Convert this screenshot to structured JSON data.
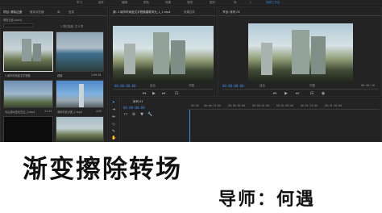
{
  "menu": [
    "学习",
    "组件",
    "编辑",
    "颜色",
    "效果",
    "音频",
    "图形",
    "库",
    "》",
    "视频工作区"
  ],
  "project_panel": {
    "tabs": [
      "项目: 擦除过渡",
      "媒体浏览器",
      "库",
      "信息"
    ],
    "file": "擦除过渡.prproj",
    "count": "1 项已选择, 共 5 项",
    "items": [
      {
        "label": "2.城市时间延文字镜像",
        "duration": ""
      },
      {
        "label": "视频",
        "duration": "1:09:18"
      },
      {
        "label": "青山绿水蓝天白云_1.mp4",
        "duration": "11:13"
      },
      {
        "label": "深圳平安大厦_1.mp4",
        "duration": "4:00"
      },
      {
        "label": "序列 14_1_1.mp4",
        "duration": ""
      },
      {
        "label": "",
        "duration": "11:13"
      }
    ]
  },
  "source_panel": {
    "tabs": [
      "源: 2.城市时间延文字镜像建筑风光_1_1.mp4",
      "效果控件"
    ],
    "timecode": "00:00:00:00",
    "fit": "适合",
    "quality": "完整"
  },
  "program_panel": {
    "tab": "节目: 序列 01",
    "timecode": "00:00:00:00",
    "fit": "适合",
    "quality": "完整",
    "end_timecode": "00:00:28"
  },
  "timeline": {
    "tab": "序列 01",
    "timecode": "00:00:00:00",
    "ruler": [
      "00:00",
      "00:00:15:00",
      "00:00:30:00",
      "00:00:45:00",
      "00:01:00:00",
      "00:01:15:00",
      "00:01:30:00"
    ]
  },
  "banner": {
    "title": "渐变擦除转场",
    "teacher": "导师：何遇"
  },
  "colors": {
    "accent": "#2f7fd6",
    "timecode": "#3f8be0",
    "banner_bg": "#ffffff"
  }
}
